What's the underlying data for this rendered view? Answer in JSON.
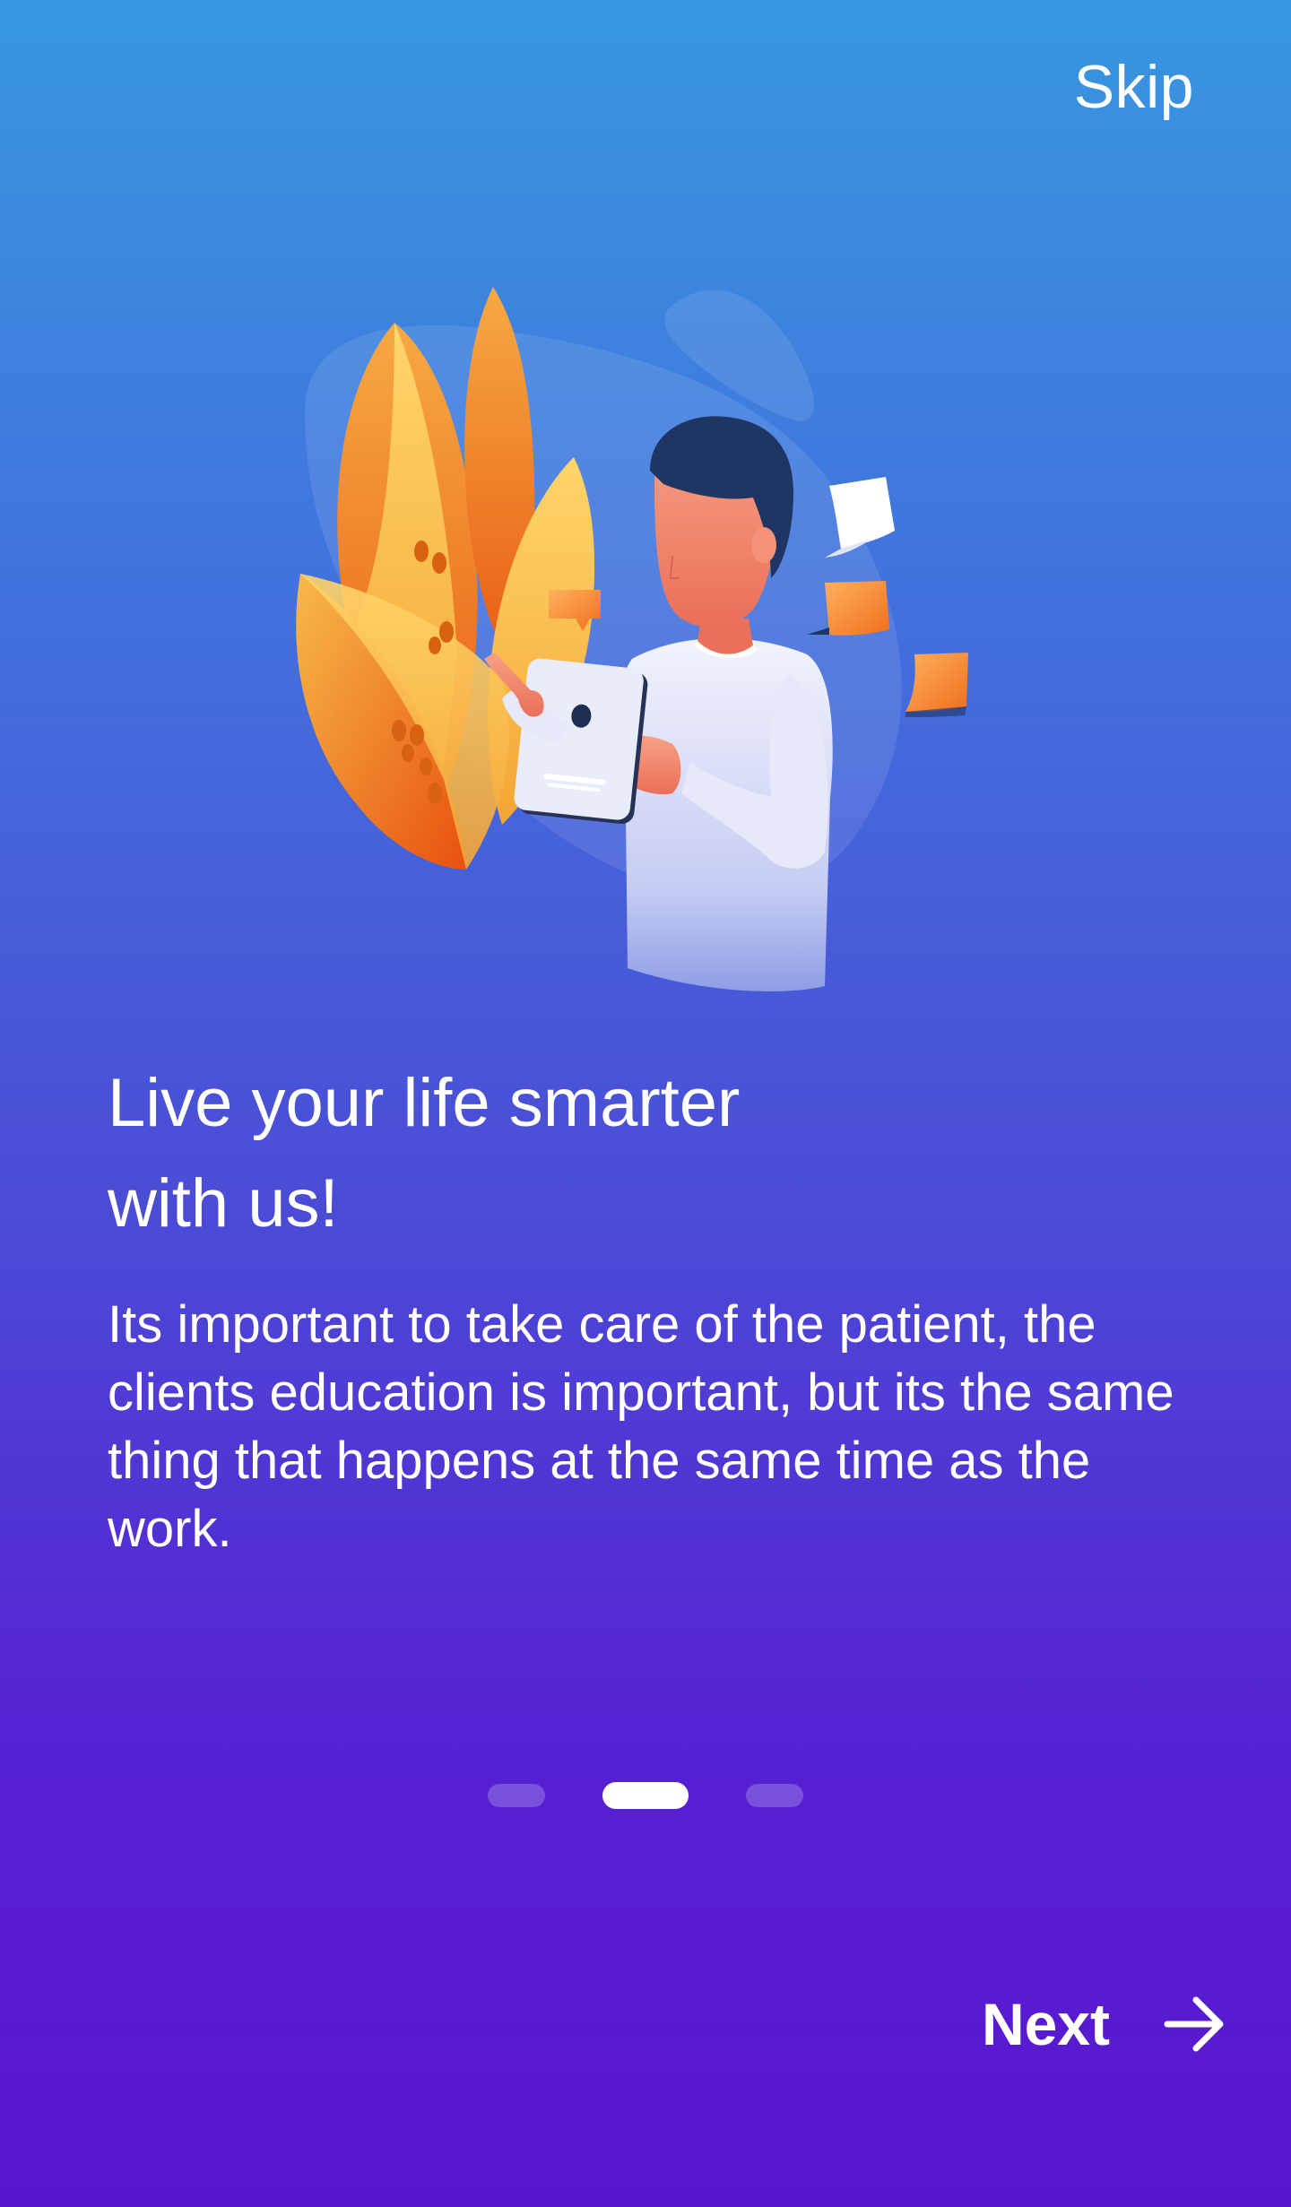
{
  "header": {
    "skip_label": "Skip"
  },
  "onboarding": {
    "title_line1": "Live your life smarter",
    "title_line2": "with us!",
    "description": "Its important to take care of the patient, the clients education is important, but its the same thing that happens at the same time as the work.",
    "illustration_icon": "person-with-tablet-illustration"
  },
  "pagination": {
    "total": 3,
    "active_index": 1
  },
  "footer": {
    "next_label": "Next",
    "next_icon": "arrow-right-icon"
  },
  "colors": {
    "gradient_top": "#3897e0",
    "gradient_mid": "#4b4bd6",
    "gradient_bottom": "#5a16cf",
    "text": "#ffffff",
    "accent_orange": "#f08a2c",
    "accent_yellow": "#ffd36b"
  }
}
